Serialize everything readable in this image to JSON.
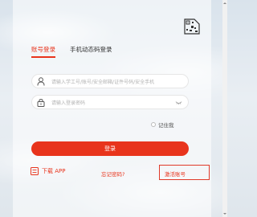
{
  "qr_icon": "qr-code-icon",
  "tabs": [
    {
      "label": "账号登录",
      "active": true
    },
    {
      "label": "手机动态码登录",
      "active": false
    }
  ],
  "fields": {
    "username": {
      "placeholder": "请输入学工号/账号/安全邮箱/证件号码/安全手机",
      "icon": "user-icon"
    },
    "password": {
      "placeholder": "请输入登录密码",
      "icon": "lock-icon"
    }
  },
  "remember": {
    "label": "记住我"
  },
  "login_button": {
    "label": "登录"
  },
  "download": {
    "label": "下载 APP",
    "icon": "app-icon"
  },
  "forgot": {
    "label": "忘记密码?"
  },
  "activate": {
    "label": "激活账号"
  },
  "colors": {
    "accent": "#e8341c",
    "highlight_box": "#e03a2a"
  }
}
